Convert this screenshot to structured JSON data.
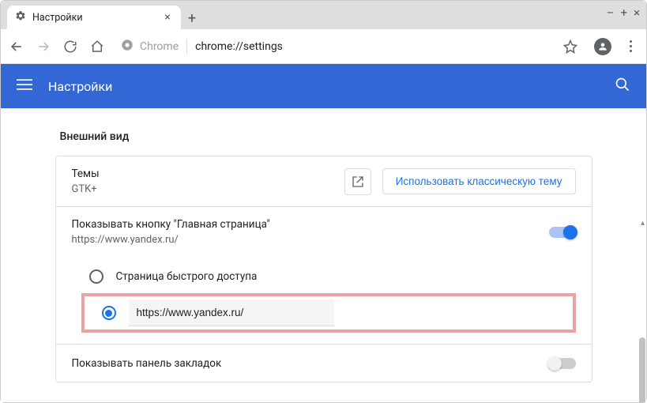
{
  "window": {
    "tab_title": "Настройки",
    "win_controls": {
      "min": "–",
      "max": "+",
      "close": "×"
    }
  },
  "nav": {
    "chrome_label": "Chrome",
    "url_path": "chrome://settings"
  },
  "header": {
    "title": "Настройки"
  },
  "section": {
    "title": "Внешний вид",
    "themes": {
      "label": "Темы",
      "sub": "GTK+",
      "classic_btn": "Использовать классическую тему"
    },
    "home_button": {
      "label": "Показывать кнопку \"Главная страница\"",
      "sub": "https://www.yandex.ru/",
      "toggle_on": true
    },
    "radio": {
      "option_newtab": "Страница быстрого доступа",
      "custom_url": "https://www.yandex.ru/",
      "selected": "custom"
    },
    "bookmarks_bar": {
      "label": "Показывать панель закладок",
      "toggle_on": false
    }
  }
}
